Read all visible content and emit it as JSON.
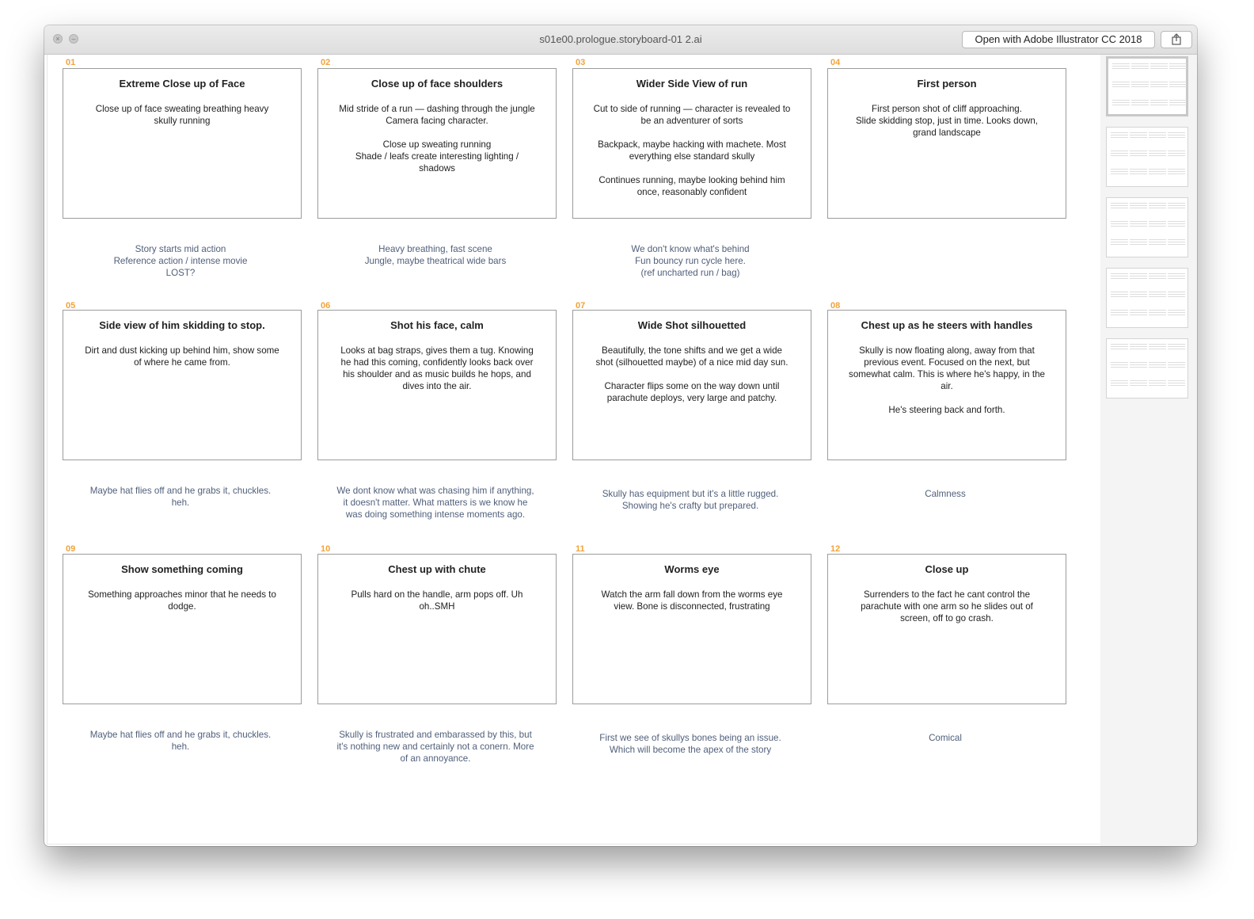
{
  "window": {
    "title": "s01e00.prologue.storyboard-01 2.ai",
    "open_with_label": "Open with Adobe Illustrator CC 2018",
    "share_icon": "share-icon"
  },
  "panels": [
    {
      "num": "01",
      "title": "Extreme Close up of Face",
      "desc": "Close up of face sweating breathing heavy\nskully running",
      "note": "Story starts mid action\nReference action / intense movie\nLOST?"
    },
    {
      "num": "02",
      "title": "Close up of face shoulders",
      "desc": "Mid stride of a run — dashing through the jungle\nCamera facing character.\n\nClose up sweating running\nShade / leafs create interesting lighting /\nshadows",
      "note": "Heavy breathing, fast scene\nJungle, maybe theatrical wide bars"
    },
    {
      "num": "03",
      "title": "Wider Side View of run",
      "desc": "Cut to side of running — character is revealed to\nbe an adventurer of sorts\n\nBackpack, maybe hacking with machete. Most\neverything else standard skully\n\nContinues running, maybe looking behind him\nonce, reasonably confident",
      "note": "We don't know what's behind\nFun bouncy run cycle here.\n(ref uncharted run / bag)"
    },
    {
      "num": "04",
      "title": "First person",
      "desc": "First person shot of cliff approaching.\nSlide skidding stop, just in time. Looks down,\ngrand landscape",
      "note": ""
    },
    {
      "num": "05",
      "title": "Side view of him skidding to stop.",
      "desc": "Dirt and dust kicking up behind him, show some\nof where he came from.",
      "note": "Maybe hat flies off and he grabs it, chuckles.\nheh."
    },
    {
      "num": "06",
      "title": "Shot his face, calm",
      "desc": "Looks at bag straps, gives them a tug. Knowing\nhe had this coming, confidently looks back over\nhis shoulder and as music builds he hops, and\ndives into the air.",
      "note": "We dont know what was chasing him if anything,\nit doesn't matter. What matters is we know he\nwas doing something intense moments ago."
    },
    {
      "num": "07",
      "title": "Wide Shot silhouetted",
      "desc": "Beautifully, the tone shifts and we get a wide\nshot (silhouetted maybe) of a nice mid day sun.\n\nCharacter flips some on the way down until\nparachute deploys, very large and patchy.",
      "note": "Skully has equipment but it's a little rugged.\nShowing he's crafty but prepared."
    },
    {
      "num": "08",
      "title": "Chest up as he steers with handles",
      "desc": "Skully is now floating along, away from that\nprevious event. Focused on the next, but\nsomewhat calm. This is where he's happy, in the\nair.\n\nHe's steering back and forth.",
      "note": "Calmness"
    },
    {
      "num": "09",
      "title": "Show something coming",
      "desc": "Something approaches minor that he needs to\ndodge.",
      "note": "Maybe hat flies off and he grabs it, chuckles.\nheh."
    },
    {
      "num": "10",
      "title": "Chest up with chute",
      "desc": "Pulls hard on the handle, arm pops off. Uh\noh..SMH",
      "note": "Skully is frustrated and embarassed by this, but\nit's nothing new and certainly not a conern. More\nof an annoyance."
    },
    {
      "num": "11",
      "title": "Worms eye",
      "desc": "Watch the arm fall down from the worms eye\nview. Bone is disconnected, frustrating",
      "note": "First we see of skullys bones being an issue.\nWhich will become the apex of the story"
    },
    {
      "num": "12",
      "title": "Close up",
      "desc": "Surrenders to the fact he cant control the\nparachute with one arm so he slides out of\nscreen, off to go crash.",
      "note": "Comical"
    }
  ],
  "sidebar": {
    "page_thumbnails": 5,
    "selected_page": 1
  }
}
